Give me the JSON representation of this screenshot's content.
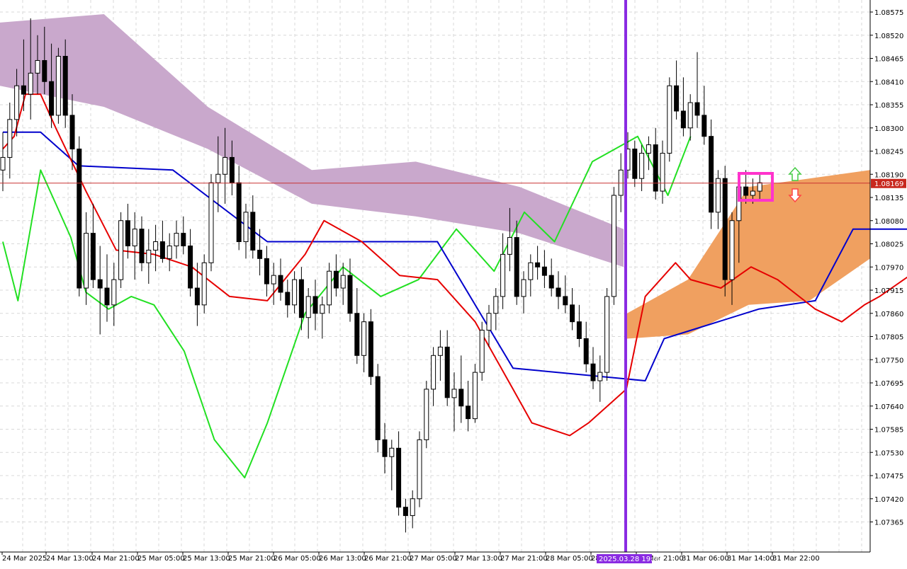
{
  "chart_data": {
    "type": "candlestick",
    "instrument_note": "",
    "y_axis": {
      "ticks": [
        "1.08575",
        "1.08520",
        "1.08465",
        "1.08410",
        "1.08355",
        "1.08300",
        "1.08245",
        "1.08190",
        "1.08135",
        "1.08080",
        "1.08025",
        "1.07970",
        "1.07915",
        "1.07860",
        "1.07805",
        "1.07750",
        "1.07695",
        "1.07640",
        "1.07585",
        "1.07530",
        "1.07475",
        "1.07420",
        "1.07365"
      ],
      "ylim": [
        1.0732,
        1.08595
      ]
    },
    "x_axis": {
      "ticks": [
        "24 Mar 2025",
        "24 Mar 13:00",
        "24 Mar 21:00",
        "25 Mar 05:00",
        "25 Mar 13:00",
        "25 Mar 21:00",
        "26 Mar 05:00",
        "26 Mar 13:00",
        "26 Mar 21:00",
        "27 Mar 05:00",
        "27 Mar 13:00",
        "27 Mar 21:00",
        "28 Mar 05:00",
        "28 Mar 13:00",
        "28 Mar 21:00",
        "31 Mar 06:00",
        "31 Mar 14:00",
        "31 Mar 22:00"
      ],
      "cursor_label": "2025.03.28 19:00"
    },
    "current_price": "1.08169",
    "grid": true,
    "colors": {
      "bull": "#ffffff",
      "bear": "#000000",
      "tenkan": "#e60000",
      "kijun": "#0000cc",
      "chikou": "#22e022",
      "kumo_bear": "#c9a8cc",
      "kumo_bull": "#f0a060",
      "price_line": "#c83232",
      "price_label_bg": "#c8281e",
      "cursor": "#8a2be2",
      "highlight": "#ff33cc",
      "arrow_up": "#44cc44",
      "arrow_down": "#ff4444"
    },
    "candles": [
      [
        1.082,
        1.0829,
        1.0815,
        1.0823
      ],
      [
        1.0823,
        1.0836,
        1.0818,
        1.0832
      ],
      [
        1.0832,
        1.0844,
        1.0828,
        1.084
      ],
      [
        1.084,
        1.0851,
        1.0834,
        1.0838
      ],
      [
        1.0838,
        1.0856,
        1.0832,
        1.0843
      ],
      [
        1.0843,
        1.0852,
        1.0838,
        1.0846
      ],
      [
        1.0846,
        1.0854,
        1.0838,
        1.0841
      ],
      [
        1.0841,
        1.085,
        1.083,
        1.0833
      ],
      [
        1.0833,
        1.0849,
        1.0831,
        1.0847
      ],
      [
        1.0847,
        1.0851,
        1.083,
        1.0833
      ],
      [
        1.0833,
        1.0838,
        1.082,
        1.0825
      ],
      [
        1.0825,
        1.0828,
        1.079,
        1.0792
      ],
      [
        1.0792,
        1.081,
        1.0788,
        1.0805
      ],
      [
        1.0805,
        1.0812,
        1.0792,
        1.0794
      ],
      [
        1.0794,
        1.0802,
        1.0781,
        1.0792
      ],
      [
        1.0792,
        1.08,
        1.0784,
        1.0788
      ],
      [
        1.0788,
        1.0798,
        1.0783,
        1.0794
      ],
      [
        1.0794,
        1.081,
        1.0792,
        1.0808
      ],
      [
        1.0808,
        1.0812,
        1.0799,
        1.0802
      ],
      [
        1.0802,
        1.081,
        1.0794,
        1.0806
      ],
      [
        1.0806,
        1.0809,
        1.0796,
        1.0798
      ],
      [
        1.0798,
        1.0806,
        1.0793,
        1.0801
      ],
      [
        1.0801,
        1.0807,
        1.0796,
        1.0803
      ],
      [
        1.0803,
        1.0808,
        1.0798,
        1.0799
      ],
      [
        1.0799,
        1.0805,
        1.0796,
        1.0802
      ],
      [
        1.0802,
        1.0808,
        1.0799,
        1.0805
      ],
      [
        1.0805,
        1.0809,
        1.08,
        1.0802
      ],
      [
        1.0802,
        1.0806,
        1.079,
        1.0792
      ],
      [
        1.0792,
        1.0798,
        1.0783,
        1.0788
      ],
      [
        1.0788,
        1.08,
        1.0786,
        1.0798
      ],
      [
        1.0798,
        1.0819,
        1.0796,
        1.0817
      ],
      [
        1.0817,
        1.0828,
        1.081,
        1.0819
      ],
      [
        1.0819,
        1.083,
        1.0812,
        1.0823
      ],
      [
        1.0823,
        1.0827,
        1.0814,
        1.0817
      ],
      [
        1.0817,
        1.0821,
        1.0801,
        1.0803
      ],
      [
        1.0803,
        1.0812,
        1.0799,
        1.081
      ],
      [
        1.081,
        1.0814,
        1.0799,
        1.0801
      ],
      [
        1.0801,
        1.0806,
        1.0795,
        1.0799
      ],
      [
        1.0799,
        1.0802,
        1.079,
        1.0793
      ],
      [
        1.0793,
        1.0798,
        1.0788,
        1.0795
      ],
      [
        1.0795,
        1.0799,
        1.0789,
        1.0791
      ],
      [
        1.0791,
        1.0794,
        1.0785,
        1.0788
      ],
      [
        1.0788,
        1.0796,
        1.0786,
        1.0794
      ],
      [
        1.0794,
        1.0797,
        1.0782,
        1.0785
      ],
      [
        1.0785,
        1.0792,
        1.078,
        1.079
      ],
      [
        1.079,
        1.0794,
        1.0782,
        1.0786
      ],
      [
        1.0786,
        1.079,
        1.078,
        1.0788
      ],
      [
        1.0788,
        1.0798,
        1.0786,
        1.0796
      ],
      [
        1.0796,
        1.08,
        1.079,
        1.0792
      ],
      [
        1.0792,
        1.0798,
        1.0788,
        1.0795
      ],
      [
        1.0795,
        1.0799,
        1.0784,
        1.0786
      ],
      [
        1.0786,
        1.0792,
        1.0774,
        1.0776
      ],
      [
        1.0776,
        1.0786,
        1.0772,
        1.0784
      ],
      [
        1.0784,
        1.0787,
        1.0769,
        1.0771
      ],
      [
        1.0771,
        1.0774,
        1.0753,
        1.0756
      ],
      [
        1.0756,
        1.076,
        1.0748,
        1.0752
      ],
      [
        1.0752,
        1.0756,
        1.0744,
        1.0754
      ],
      [
        1.0754,
        1.0758,
        1.0738,
        1.074
      ],
      [
        1.074,
        1.0742,
        1.0734,
        1.0738
      ],
      [
        1.0738,
        1.0744,
        1.0735,
        1.0742
      ],
      [
        1.0742,
        1.0758,
        1.074,
        1.0756
      ],
      [
        1.0756,
        1.077,
        1.0754,
        1.0768
      ],
      [
        1.0768,
        1.0778,
        1.0764,
        1.0776
      ],
      [
        1.0776,
        1.0782,
        1.077,
        1.0778
      ],
      [
        1.0778,
        1.0782,
        1.0764,
        1.0766
      ],
      [
        1.0766,
        1.0772,
        1.0758,
        1.0768
      ],
      [
        1.0768,
        1.0776,
        1.076,
        1.0764
      ],
      [
        1.0764,
        1.077,
        1.0758,
        1.0761
      ],
      [
        1.0761,
        1.0774,
        1.076,
        1.0772
      ],
      [
        1.0772,
        1.0784,
        1.077,
        1.0782
      ],
      [
        1.0782,
        1.0788,
        1.0778,
        1.0786
      ],
      [
        1.0786,
        1.0792,
        1.0782,
        1.079
      ],
      [
        1.079,
        1.0805,
        1.0787,
        1.08
      ],
      [
        1.08,
        1.0811,
        1.0796,
        1.0804
      ],
      [
        1.0804,
        1.0808,
        1.0788,
        1.079
      ],
      [
        1.079,
        1.0796,
        1.0786,
        1.0794
      ],
      [
        1.0794,
        1.08,
        1.079,
        1.0798
      ],
      [
        1.0798,
        1.0802,
        1.0794,
        1.0797
      ],
      [
        1.0797,
        1.0801,
        1.0792,
        1.0795
      ],
      [
        1.0795,
        1.0799,
        1.079,
        1.0792
      ],
      [
        1.0792,
        1.0796,
        1.0787,
        1.079
      ],
      [
        1.079,
        1.0795,
        1.0786,
        1.0788
      ],
      [
        1.0788,
        1.0792,
        1.0782,
        1.0784
      ],
      [
        1.0784,
        1.0788,
        1.0778,
        1.078
      ],
      [
        1.078,
        1.0784,
        1.0772,
        1.0774
      ],
      [
        1.0774,
        1.0778,
        1.0768,
        1.077
      ],
      [
        1.077,
        1.0776,
        1.0765,
        1.0772
      ],
      [
        1.0772,
        1.0792,
        1.077,
        1.079
      ],
      [
        1.079,
        1.0816,
        1.0788,
        1.0814
      ],
      [
        1.0814,
        1.0824,
        1.081,
        1.082
      ],
      [
        1.082,
        1.0829,
        1.0818,
        1.0825
      ],
      [
        1.0825,
        1.0827,
        1.0816,
        1.0818
      ],
      [
        1.0818,
        1.0826,
        1.0815,
        1.0824
      ],
      [
        1.0824,
        1.0828,
        1.082,
        1.0826
      ],
      [
        1.0826,
        1.083,
        1.0813,
        1.0815
      ],
      [
        1.0815,
        1.0827,
        1.0812,
        1.0824
      ],
      [
        1.0824,
        1.0842,
        1.0822,
        1.084
      ],
      [
        1.084,
        1.0846,
        1.0832,
        1.0834
      ],
      [
        1.0834,
        1.0842,
        1.0828,
        1.083
      ],
      [
        1.083,
        1.0838,
        1.0827,
        1.0836
      ],
      [
        1.0836,
        1.0848,
        1.083,
        1.0833
      ],
      [
        1.0833,
        1.084,
        1.0826,
        1.0828
      ],
      [
        1.0828,
        1.0832,
        1.0806,
        1.081
      ],
      [
        1.081,
        1.082,
        1.0806,
        1.0818
      ],
      [
        1.0818,
        1.0821,
        1.079,
        1.0794
      ],
      [
        1.0794,
        1.081,
        1.0788,
        1.0808
      ],
      [
        1.0808,
        1.0819,
        1.0798,
        1.0816
      ],
      [
        1.0816,
        1.082,
        1.0812,
        1.0814
      ],
      [
        1.0814,
        1.0818,
        1.0812,
        1.0815
      ],
      [
        1.0815,
        1.0819,
        1.0813,
        1.0817
      ]
    ],
    "tenkan": [
      [
        0,
        1.0825
      ],
      [
        3,
        1.0828
      ],
      [
        6,
        1.0838
      ],
      [
        10,
        1.0838
      ],
      [
        14,
        1.083
      ],
      [
        22,
        1.0815
      ],
      [
        30,
        1.0801
      ],
      [
        40,
        1.08
      ],
      [
        50,
        1.0797
      ],
      [
        60,
        1.079
      ],
      [
        70,
        1.0789
      ],
      [
        80,
        1.08
      ],
      [
        85,
        1.0808
      ],
      [
        95,
        1.0803
      ],
      [
        105,
        1.0795
      ],
      [
        115,
        1.0794
      ],
      [
        125,
        1.0784
      ],
      [
        135,
        1.0768
      ],
      [
        140,
        1.076
      ],
      [
        150,
        1.0757
      ],
      [
        155,
        1.076
      ],
      [
        165,
        1.0768
      ],
      [
        170,
        1.079
      ],
      [
        178,
        1.0798
      ],
      [
        182,
        1.0794
      ],
      [
        190,
        1.0792
      ],
      [
        198,
        1.0797
      ],
      [
        205,
        1.0794
      ],
      [
        215,
        1.0787
      ],
      [
        222,
        1.0784
      ],
      [
        228,
        1.0788
      ],
      [
        232,
        1.079
      ],
      [
        240,
        1.0795
      ]
    ],
    "kijun": [
      [
        0,
        1.0829
      ],
      [
        10,
        1.0829
      ],
      [
        20,
        1.0821
      ],
      [
        45,
        1.082
      ],
      [
        70,
        1.0803
      ],
      [
        115,
        1.0803
      ],
      [
        135,
        1.0773
      ],
      [
        170,
        1.077
      ],
      [
        175,
        1.078
      ],
      [
        200,
        1.0787
      ],
      [
        215,
        1.0789
      ],
      [
        225,
        1.0806
      ],
      [
        240,
        1.0806
      ]
    ],
    "chikou": [
      [
        0,
        1.0803
      ],
      [
        4,
        1.0789
      ],
      [
        10,
        1.082
      ],
      [
        14,
        1.0812
      ],
      [
        18,
        1.0804
      ],
      [
        22,
        1.0791
      ],
      [
        28,
        1.0787
      ],
      [
        34,
        1.079
      ],
      [
        40,
        1.0788
      ],
      [
        48,
        1.0777
      ],
      [
        56,
        1.0756
      ],
      [
        64,
        1.0747
      ],
      [
        70,
        1.076
      ],
      [
        80,
        1.0786
      ],
      [
        90,
        1.0797
      ],
      [
        100,
        1.079
      ],
      [
        110,
        1.0794
      ],
      [
        120,
        1.0806
      ],
      [
        130,
        1.0796
      ],
      [
        138,
        1.081
      ],
      [
        146,
        1.0803
      ],
      [
        156,
        1.0822
      ],
      [
        168,
        1.0828
      ],
      [
        176,
        1.0814
      ],
      [
        182,
        1.0828
      ]
    ],
    "kumo_bearish": [
      [
        1.0855,
        1.084
      ],
      [
        1.0857,
        1.0835
      ],
      [
        1.0835,
        1.0825
      ],
      [
        1.082,
        1.0812
      ],
      [
        1.0822,
        1.0809
      ],
      [
        1.0816,
        1.0805
      ],
      [
        1.0806,
        1.0797
      ]
    ],
    "kumo_bullish": [
      [
        1.0786,
        1.078
      ],
      [
        1.0794,
        1.0781
      ],
      [
        1.0816,
        1.0788
      ],
      [
        1.0818,
        1.0789
      ],
      [
        1.082,
        1.0799
      ]
    ]
  }
}
